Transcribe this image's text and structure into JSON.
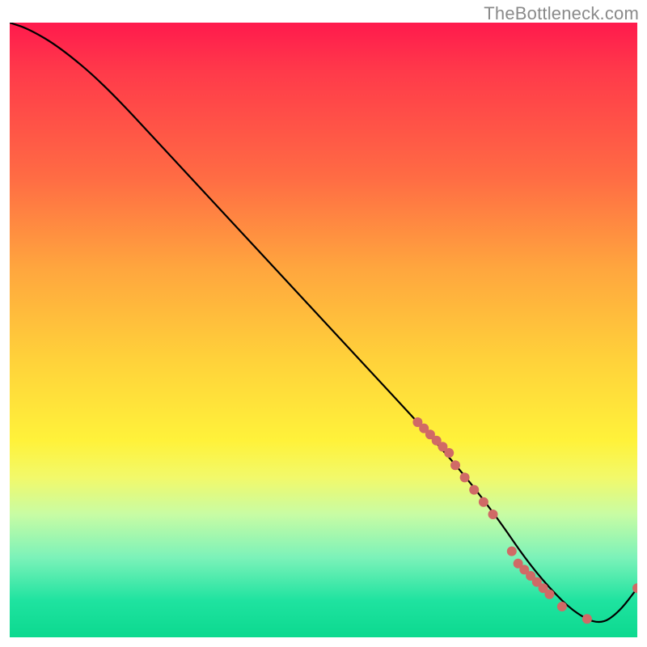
{
  "watermark": "TheBottleneck.com",
  "colors": {
    "gradient_top": "#ff1a4d",
    "gradient_mid": "#ffd23a",
    "gradient_bottom": "#0cd98f",
    "curve": "#000000",
    "marker": "#d06a66"
  },
  "chart_data": {
    "type": "line",
    "title": "",
    "xlabel": "",
    "ylabel": "",
    "xlim": [
      0,
      100
    ],
    "ylim": [
      0,
      100
    ],
    "series": [
      {
        "name": "curve",
        "x": [
          0,
          3,
          8,
          15,
          25,
          35,
          45,
          55,
          65,
          72,
          78,
          82,
          86,
          90,
          94,
          97,
          100
        ],
        "y": [
          100,
          99,
          96,
          90,
          79,
          68,
          57,
          46,
          35,
          27,
          19,
          13,
          8,
          4,
          2,
          4,
          8
        ]
      }
    ],
    "markers": {
      "name": "dots",
      "x": [
        65,
        66,
        67,
        68,
        69,
        70,
        71,
        72.5,
        74,
        75.5,
        77,
        80,
        81,
        82,
        83,
        84,
        85,
        86,
        88,
        92,
        100
      ],
      "y": [
        35,
        34,
        33,
        32,
        31,
        30,
        28,
        26,
        24,
        22,
        20,
        14,
        12,
        11,
        10,
        9,
        8,
        7,
        5,
        3,
        8
      ]
    }
  }
}
